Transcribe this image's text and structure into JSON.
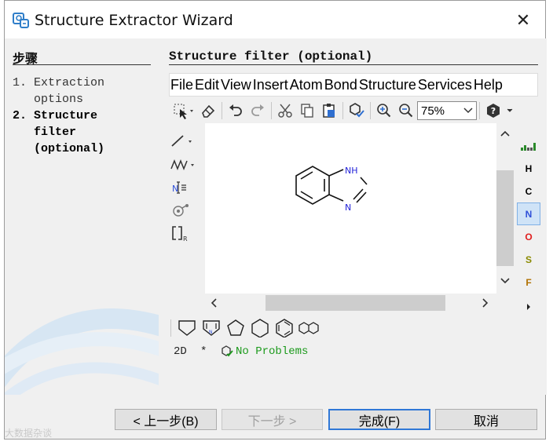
{
  "window": {
    "title": "Structure Extractor Wizard",
    "close_label": "✕"
  },
  "steps": {
    "title": "步骤",
    "items": [
      {
        "number": "1.",
        "label": "Extraction\noptions",
        "active": false
      },
      {
        "number": "2.",
        "label": "Structure\nfilter\n(optional)",
        "active": true
      }
    ]
  },
  "content": {
    "title": "Structure filter (optional)",
    "menu": [
      "File",
      "Edit",
      "View",
      "Insert",
      "Atom",
      "Bond",
      "Structure",
      "Services",
      "Help"
    ],
    "zoom_value": "75%",
    "molecule": {
      "atom_labels": [
        "NH",
        "N"
      ],
      "atom_color": "#1f1fd8"
    },
    "element_buttons": [
      {
        "symbol": "H",
        "color": "#222222"
      },
      {
        "symbol": "C",
        "color": "#222222"
      },
      {
        "symbol": "N",
        "color": "#2f4fd8",
        "selected": true
      },
      {
        "symbol": "O",
        "color": "#e02020"
      },
      {
        "symbol": "S",
        "color": "#8a8a00"
      },
      {
        "symbol": "F",
        "color": "#b07000"
      }
    ],
    "status": {
      "mode": "2D",
      "star": "*",
      "message": "No Problems",
      "message_color": "#1c9a1c"
    }
  },
  "footer": {
    "back": "< 上一步(B)",
    "next": "下一步 >",
    "finish": "完成(F)",
    "cancel": "取消"
  },
  "watermark": "大数据杂谈"
}
